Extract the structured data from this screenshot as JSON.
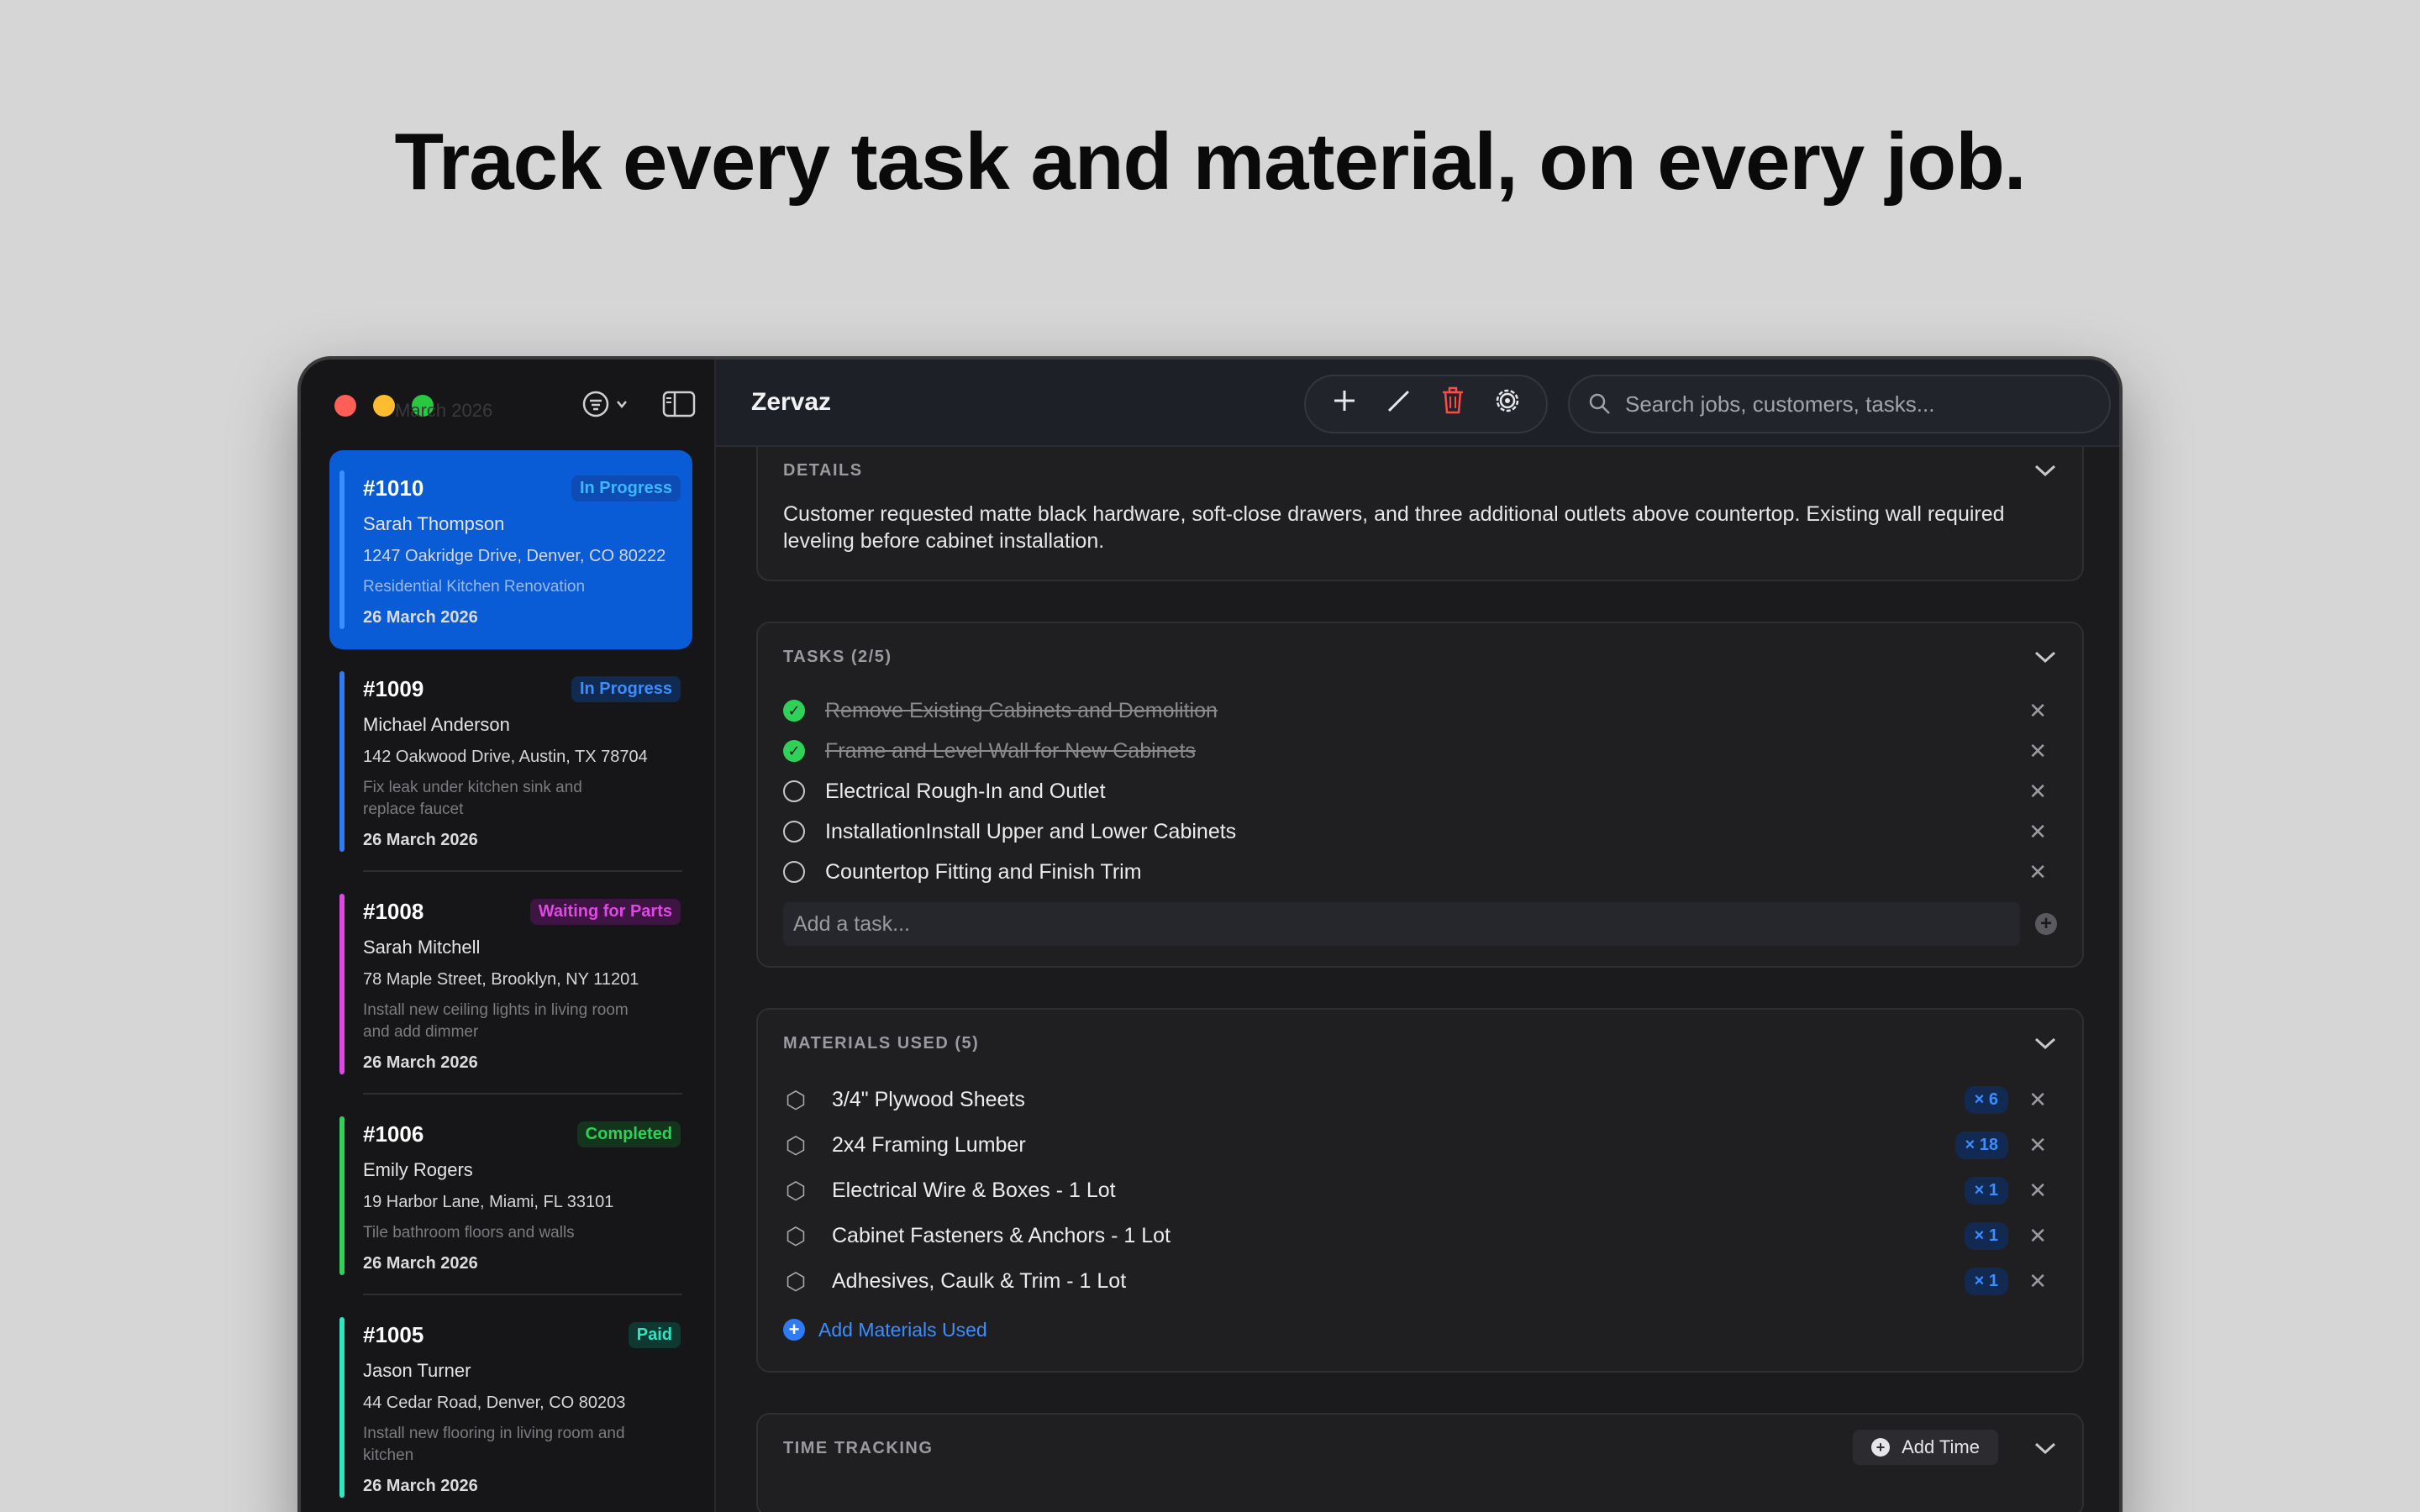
{
  "headline": "Track every task and material, on every job.",
  "sidebar": {
    "ghost_text": "March 2026",
    "jobs": [
      {
        "number": "#1010",
        "status": "In Progress",
        "status_color": "#3c8dff",
        "bar_color": "#3c8dff",
        "customer": "Sarah Thompson",
        "address": "1247 Oakridge Drive, Denver, CO 80222",
        "description": "Residential Kitchen Renovation",
        "date": "26 March 2026"
      },
      {
        "number": "#1009",
        "status": "In Progress",
        "status_color": "#3c8dff",
        "bar_color": "#2f7bf6",
        "customer": "Michael Anderson",
        "address": "142 Oakwood Drive, Austin, TX 78704",
        "description": "Fix leak under kitchen sink and replace faucet",
        "date": "26 March 2026"
      },
      {
        "number": "#1008",
        "status": "Waiting for Parts",
        "status_color": "#e048e6",
        "bar_color": "#e048e6",
        "customer": "Sarah Mitchell",
        "address": "78 Maple Street, Brooklyn, NY 11201",
        "description": "Install new ceiling lights in living room and add dimmer",
        "date": "26 March 2026"
      },
      {
        "number": "#1006",
        "status": "Completed",
        "status_color": "#30d158",
        "bar_color": "#30d158",
        "customer": "Emily Rogers",
        "address": "19 Harbor Lane, Miami, FL 33101",
        "description": "Tile bathroom floors and walls",
        "date": "26 March 2026"
      },
      {
        "number": "#1005",
        "status": "Paid",
        "status_color": "#2ee6c0",
        "bar_color": "#2ee6c0",
        "customer": "Jason Turner",
        "address": "44 Cedar Road, Denver, CO 80203",
        "description": "Install new flooring in living room and kitchen",
        "date": "26 March 2026"
      }
    ]
  },
  "topbar": {
    "app_title": "Zervaz",
    "search_placeholder": "Search jobs, customers, tasks..."
  },
  "details": {
    "title": "DETAILS",
    "text": "Customer requested matte black hardware, soft-close drawers, and three additional outlets above countertop. Existing wall required leveling before cabinet installation."
  },
  "tasks": {
    "title": "TASKS (2/5)",
    "items": [
      {
        "label": "Remove Existing Cabinets and Demolition",
        "done": true
      },
      {
        "label": "Frame and Level Wall for New Cabinets",
        "done": true
      },
      {
        "label": "Electrical Rough-In and Outlet",
        "done": false
      },
      {
        "label": "InstallationInstall Upper and Lower Cabinets",
        "done": false
      },
      {
        "label": "Countertop Fitting and Finish Trim",
        "done": false
      }
    ],
    "add_placeholder": "Add a task..."
  },
  "materials": {
    "title": "MATERIALS USED (5)",
    "items": [
      {
        "name": "3/4\" Plywood Sheets",
        "qty": "× 6"
      },
      {
        "name": "2x4 Framing Lumber",
        "qty": "× 18"
      },
      {
        "name": "Electrical Wire & Boxes - 1 Lot",
        "qty": "× 1"
      },
      {
        "name": "Cabinet Fasteners & Anchors - 1 Lot",
        "qty": "× 1"
      },
      {
        "name": "Adhesives, Caulk & Trim - 1 Lot",
        "qty": "× 1"
      }
    ],
    "add_label": "Add Materials Used"
  },
  "time_tracking": {
    "title": "TIME TRACKING",
    "add_label": "Add Time"
  },
  "accent_colors": {
    "selected": "#0a5bd6",
    "destructive": "#ff4b48",
    "link": "#3c8dff"
  }
}
